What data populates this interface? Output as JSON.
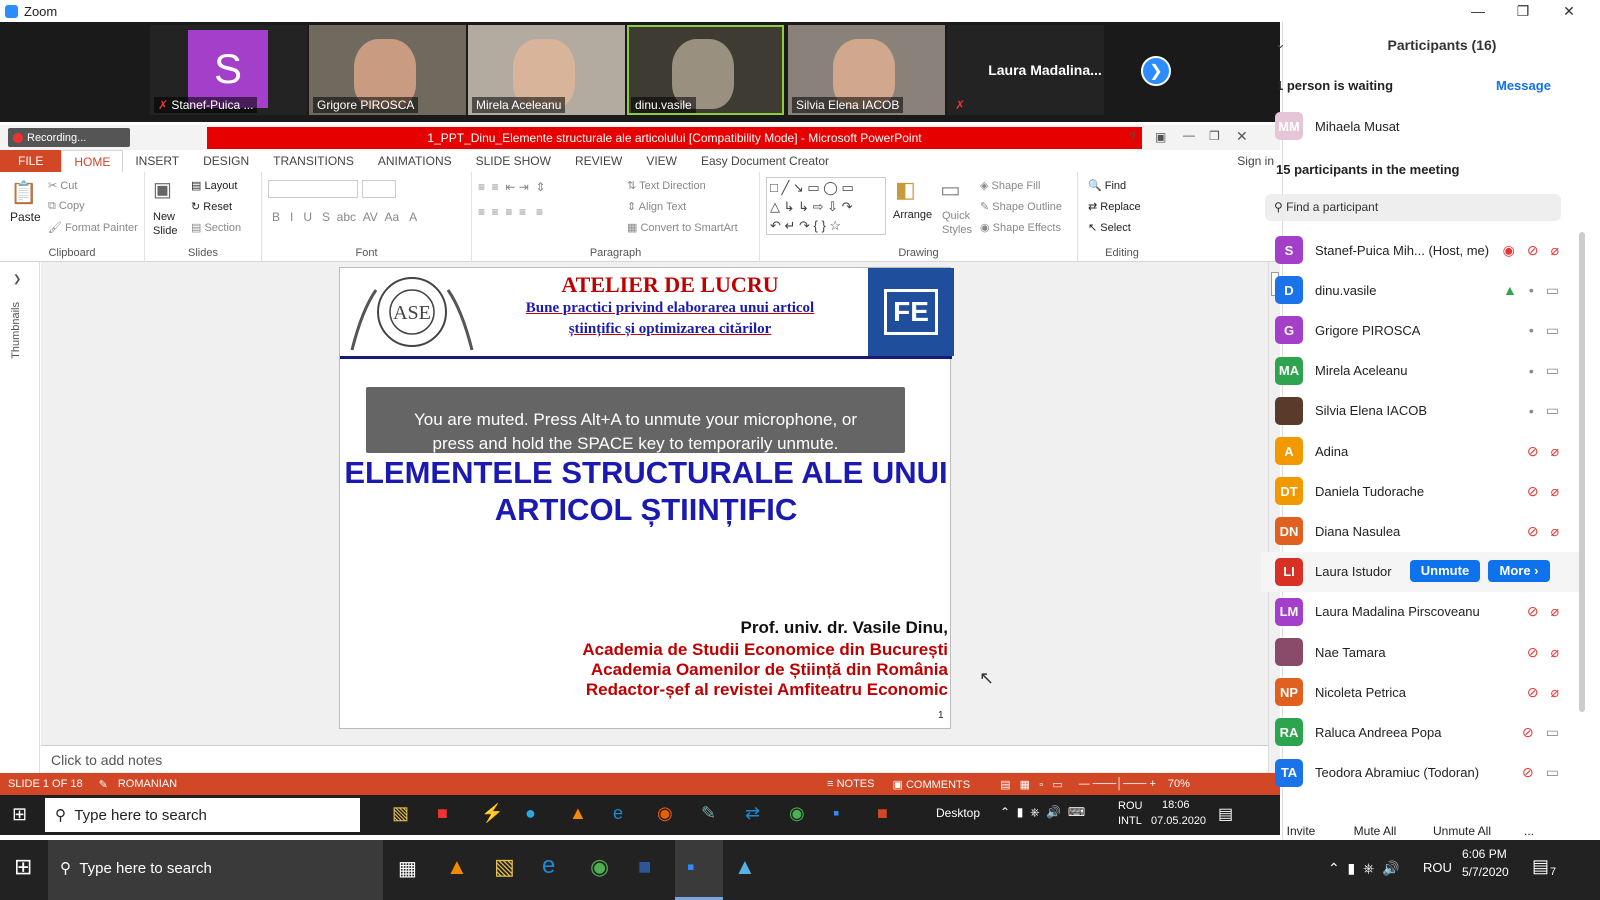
{
  "window": {
    "app_title": "Zoom"
  },
  "videos": [
    {
      "name": "Stanef-Puica ...",
      "initial": "S"
    },
    {
      "name": "Grigore PIROSCA"
    },
    {
      "name": "Mirela Aceleanu"
    },
    {
      "name": "dinu.vasile"
    },
    {
      "name": "Silvia Elena IACOB"
    },
    {
      "name": "Laura  Madalina..."
    }
  ],
  "ppt": {
    "recording": "Recording...",
    "title": "1_PPT_Dinu_Elemente structurale ale articolului [Compatibility Mode] -  Microsoft PowerPoint",
    "sign_in": "Sign in",
    "tabs": [
      "FILE",
      "HOME",
      "INSERT",
      "DESIGN",
      "TRANSITIONS",
      "ANIMATIONS",
      "SLIDE SHOW",
      "REVIEW",
      "VIEW",
      "Easy Document Creator"
    ],
    "ribbon": {
      "paste": "Paste",
      "cut": "Cut",
      "copy": "Copy",
      "format_painter": "Format Painter",
      "clipboard": "Clipboard",
      "new_slide": "New Slide",
      "layout": "Layout",
      "reset": "Reset",
      "section": "Section",
      "slides": "Slides",
      "font": "Font",
      "paragraph": "Paragraph",
      "text_direction": "Text Direction",
      "align_text": "Align Text",
      "convert_smartart": "Convert to SmartArt",
      "arrange": "Arrange",
      "quick_styles": "Quick Styles",
      "shape_fill": "Shape Fill",
      "shape_outline": "Shape Outline",
      "shape_effects": "Shape Effects",
      "drawing": "Drawing",
      "find": "Find",
      "replace": "Replace",
      "select": "Select",
      "editing": "Editing"
    },
    "thumbnails": "Thumbnails",
    "slide": {
      "header_title": "ATELIER DE LUCRU",
      "header_sub1": "Bune practici privind elaborarea unui articol",
      "header_sub2": "științific și optimizarea citărilor",
      "logo_text": "FE",
      "muted_msg1": "You are muted. Press Alt+A to unmute your microphone, or",
      "muted_msg2": "press and hold the SPACE key to temporarily unmute.",
      "main_title1": "ELEMENTELE STRUCTURALE ALE UNUI",
      "main_title2": "ARTICOL ȘTIINȚIFIC",
      "author": "Prof. univ. dr. Vasile Dinu,",
      "aff1": "Academia de Studii Economice din București",
      "aff2": "Academia Oamenilor de Știință din România",
      "aff3": "Redactor-șef al revistei Amfiteatru Economic",
      "page": "1"
    },
    "notes_placeholder": "Click to add notes",
    "status": {
      "slide": "SLIDE 1 OF 18",
      "lang": "ROMANIAN",
      "notes": "NOTES",
      "comments": "COMMENTS",
      "zoom": "70%"
    },
    "inner_taskbar": {
      "search": "Type here to search",
      "desktop": "Desktop",
      "lang1": "ROU",
      "lang2": "INTL",
      "time": "18:06",
      "date": "07.05.2020"
    }
  },
  "taskbar": {
    "search": "Type here to search",
    "lang": "ROU",
    "time": "6:06 PM",
    "date": "5/7/2020",
    "notif": "7"
  },
  "panel": {
    "title": "Participants (16)",
    "waiting": "1 person is waiting",
    "message": "Message",
    "waiting_person": {
      "initials": "MM",
      "name": "Mihaela Musat"
    },
    "in_meeting": "15 participants in the meeting",
    "search_placeholder": "Find a participant",
    "participants": [
      {
        "initials": "S",
        "name": "Stanef-Puica Mih... (Host, me)",
        "color": "#a33fc9"
      },
      {
        "initials": "D",
        "name": "dinu.vasile",
        "color": "#1a73e8"
      },
      {
        "initials": "G",
        "name": "Grigore PIROSCA",
        "color": "#a33fc9"
      },
      {
        "initials": "MA",
        "name": "Mirela Aceleanu",
        "color": "#2ea44f"
      },
      {
        "initials": "",
        "name": "Silvia Elena IACOB",
        "color": "#5a3a2a"
      },
      {
        "initials": "A",
        "name": "Adina",
        "color": "#f29900"
      },
      {
        "initials": "DT",
        "name": "Daniela Tudorache",
        "color": "#f29900"
      },
      {
        "initials": "DN",
        "name": "Diana Nasulea",
        "color": "#e0601f"
      },
      {
        "initials": "LI",
        "name": "Laura Istudor",
        "color": "#d93025"
      },
      {
        "initials": "LM",
        "name": "Laura Madalina Pirscoveanu",
        "color": "#a33fc9"
      },
      {
        "initials": "",
        "name": "Nae Tamara",
        "color": "#8a4a6a"
      },
      {
        "initials": "NP",
        "name": "Nicoleta Petrica",
        "color": "#e0601f"
      },
      {
        "initials": "RA",
        "name": "Raluca Andreea Popa",
        "color": "#2ea44f"
      },
      {
        "initials": "TA",
        "name": "Teodora Abramiuc (Todoran)",
        "color": "#1a73e8"
      }
    ],
    "unmute": "Unmute",
    "more": "More ›",
    "invite": "Invite",
    "mute_all": "Mute All",
    "unmute_all": "Unmute All",
    "dots": "..."
  }
}
